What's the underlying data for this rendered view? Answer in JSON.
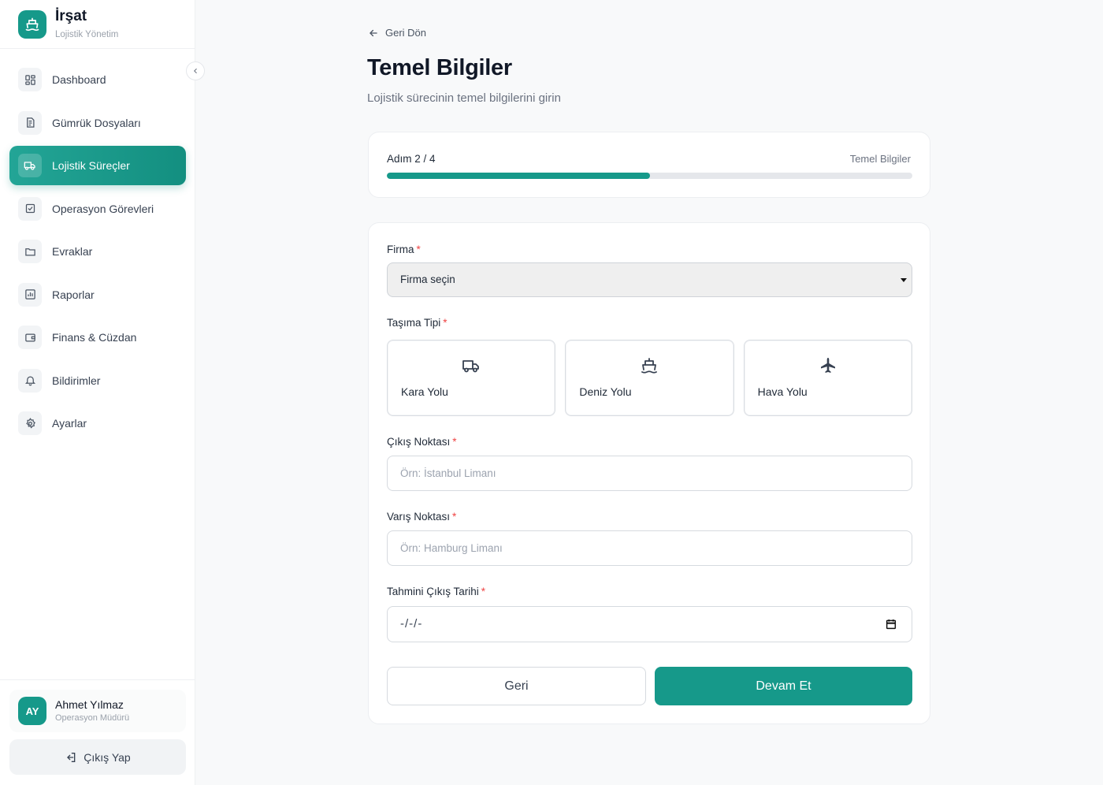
{
  "brand": {
    "title": "İrşat",
    "subtitle": "Lojistik Yönetim"
  },
  "sidebar": {
    "items": [
      {
        "label": "Dashboard",
        "icon": "dashboard-icon",
        "active": false
      },
      {
        "label": "Gümrük Dosyaları",
        "icon": "document-icon",
        "active": false
      },
      {
        "label": "Lojistik Süreçler",
        "icon": "truck-icon",
        "active": true
      },
      {
        "label": "Operasyon Görevleri",
        "icon": "checkbox-icon",
        "active": false
      },
      {
        "label": "Evraklar",
        "icon": "folder-icon",
        "active": false
      },
      {
        "label": "Raporlar",
        "icon": "chart-icon",
        "active": false
      },
      {
        "label": "Finans & Cüzdan",
        "icon": "wallet-icon",
        "active": false
      },
      {
        "label": "Bildirimler",
        "icon": "bell-icon",
        "active": false
      },
      {
        "label": "Ayarlar",
        "icon": "gear-icon",
        "active": false
      }
    ]
  },
  "user": {
    "initials": "AY",
    "name": "Ahmet Yılmaz",
    "role": "Operasyon Müdürü"
  },
  "logout_label": "Çıkış Yap",
  "main": {
    "back_label": "Geri Dön",
    "title": "Temel Bilgiler",
    "subtitle": "Lojistik sürecinin temel bilgilerini girin"
  },
  "progress": {
    "step_label": "Adım 2 / 4",
    "step_name": "Temel Bilgiler",
    "fraction": 0.5
  },
  "form": {
    "company": {
      "label": "Firma",
      "required": "*",
      "value": "Firma seçin"
    },
    "transport": {
      "label": "Taşıma Tipi",
      "required": "*",
      "options": [
        {
          "label": "Kara Yolu",
          "icon": "truck-icon"
        },
        {
          "label": "Deniz Yolu",
          "icon": "ship-icon"
        },
        {
          "label": "Hava Yolu",
          "icon": "plane-icon"
        }
      ]
    },
    "origin": {
      "label": "Çıkış Noktası",
      "required": "*",
      "placeholder": "Örn: İstanbul Limanı"
    },
    "destination": {
      "label": "Varış Noktası",
      "required": "*",
      "placeholder": "Örn: Hamburg Limanı"
    },
    "departure_date": {
      "label": "Tahmini Çıkış Tarihi",
      "required": "*",
      "value": "-/-/-"
    },
    "back_button": "Geri",
    "next_button": "Devam Et"
  },
  "colors": {
    "accent": "#16998a",
    "required": "#ef4444"
  }
}
